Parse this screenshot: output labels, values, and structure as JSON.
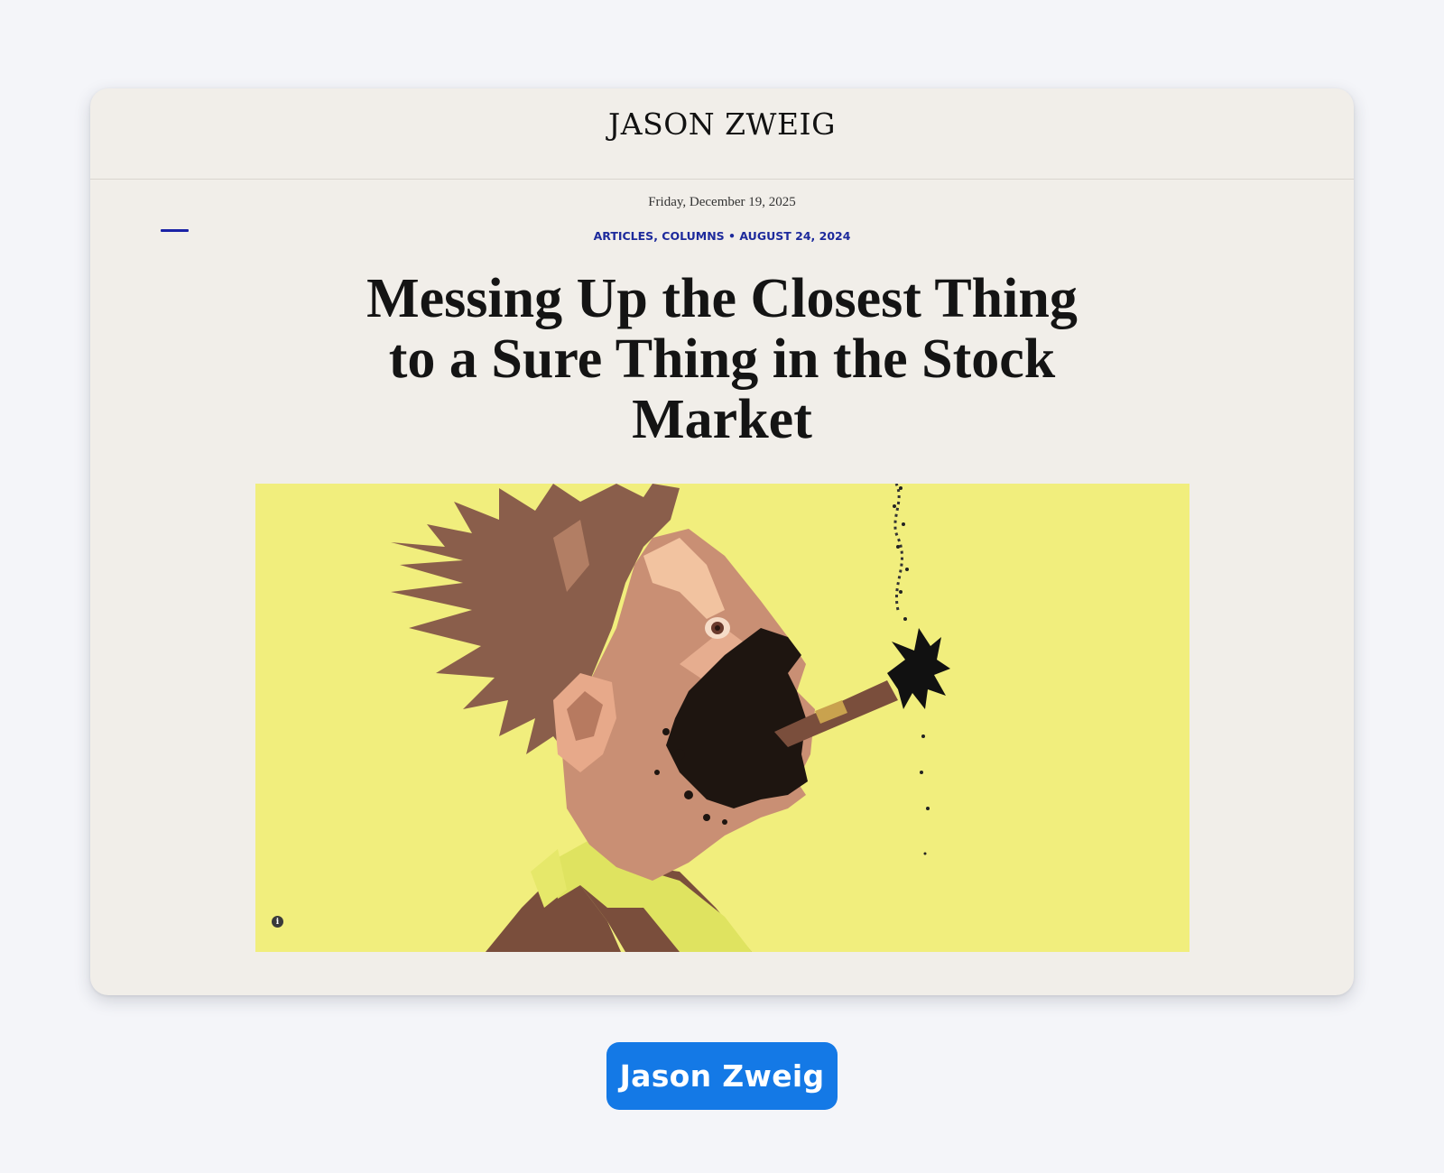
{
  "site": {
    "title": "JASON ZWEIG"
  },
  "nav": {
    "menu_icon": "menu-icon"
  },
  "article": {
    "date": "Friday, December 19, 2025",
    "categories": [
      "ARTICLES",
      "COLUMNS"
    ],
    "category_separator": ",",
    "meta_separator": "•",
    "published": "AUGUST 24, 2024",
    "headline": "Messing Up the Closest Thing to a Sure Thing in the Stock Market",
    "hero_image": {
      "description_icon": "man-smoking-exploding-cigar-illustration",
      "info_icon": "info-icon",
      "background_color": "#f1ee7d"
    }
  },
  "footer_button": {
    "label": "Jason Zweig",
    "color": "#1479e6"
  },
  "colors": {
    "page_background": "#f4f5f9",
    "card_background": "#f1eee9",
    "accent_blue": "#1d2a9c"
  }
}
